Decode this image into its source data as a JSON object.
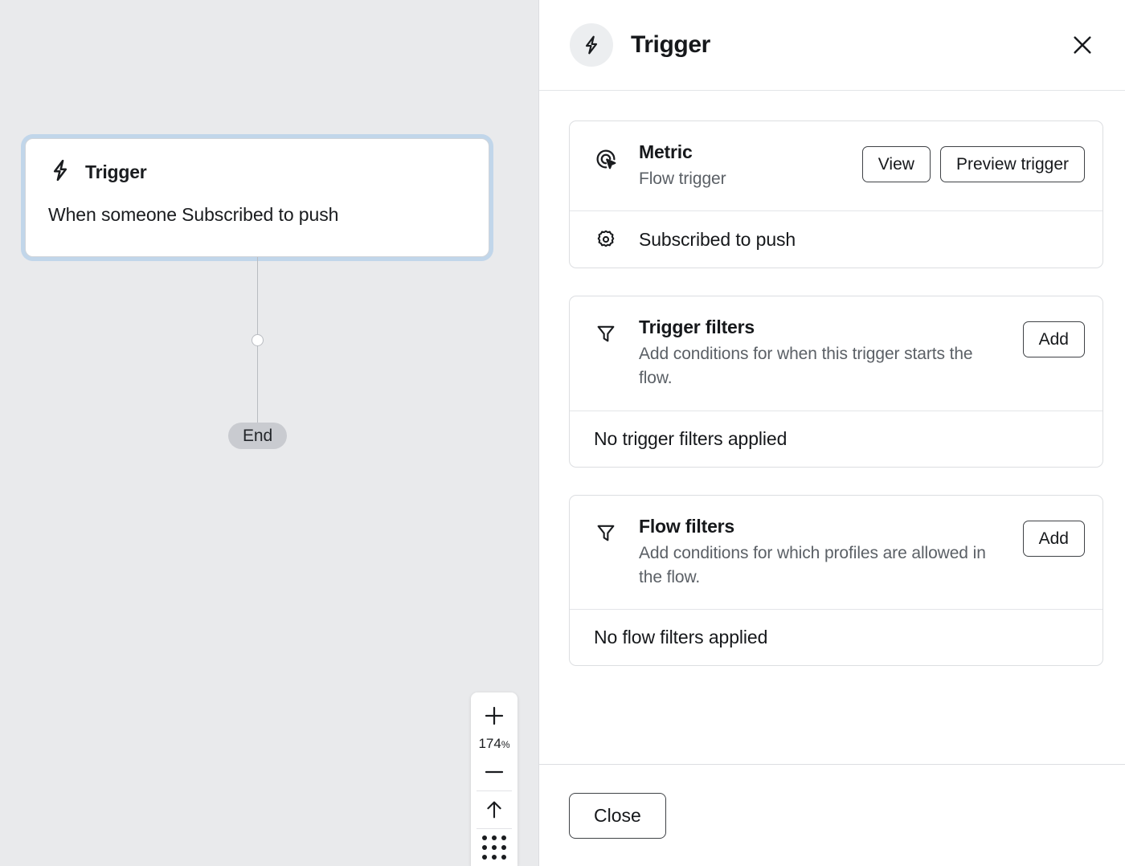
{
  "canvas": {
    "trigger_node": {
      "icon": "lightning-bolt-icon",
      "title": "Trigger",
      "description": "When someone Subscribed to push"
    },
    "end_label": "End",
    "zoom_toolbar": {
      "zoom_in_icon": "plus-icon",
      "zoom_level": "174",
      "zoom_level_unit": "%",
      "zoom_out_icon": "minus-icon",
      "collapse_icon": "arrow-up-icon",
      "grid_icon": "dots-grid-icon"
    }
  },
  "panel": {
    "header": {
      "icon": "lightning-bolt-icon",
      "title": "Trigger",
      "close_icon": "close-icon"
    },
    "cards": [
      {
        "icon": "click-target-icon",
        "title": "Metric",
        "subtitle": "Flow trigger",
        "actions": [
          {
            "label": "View",
            "name": "view-button"
          },
          {
            "label": "Preview trigger",
            "name": "preview-trigger-button"
          }
        ],
        "row": {
          "icon": "gear-icon",
          "text": "Subscribed to push"
        }
      },
      {
        "icon": "filter-icon",
        "title": "Trigger filters",
        "subtitle": "Add conditions for when this trigger starts the flow.",
        "actions": [
          {
            "label": "Add",
            "name": "add-trigger-filter-button"
          }
        ],
        "row": {
          "icon": "",
          "text": "No trigger filters applied"
        }
      },
      {
        "icon": "filter-icon",
        "title": "Flow filters",
        "subtitle": "Add conditions for which profiles are allowed in the flow.",
        "actions": [
          {
            "label": "Add",
            "name": "add-flow-filter-button"
          }
        ],
        "row": {
          "icon": "",
          "text": "No flow filters applied"
        }
      }
    ],
    "footer": {
      "close_label": "Close"
    }
  },
  "colors": {
    "canvas_background": "#e9eaec",
    "selection_ring": "#a0c5ea",
    "panel_background": "#ffffff",
    "border": "#dcdee1",
    "muted_text": "#5b6066",
    "end_pill": "#c9cbd0"
  }
}
